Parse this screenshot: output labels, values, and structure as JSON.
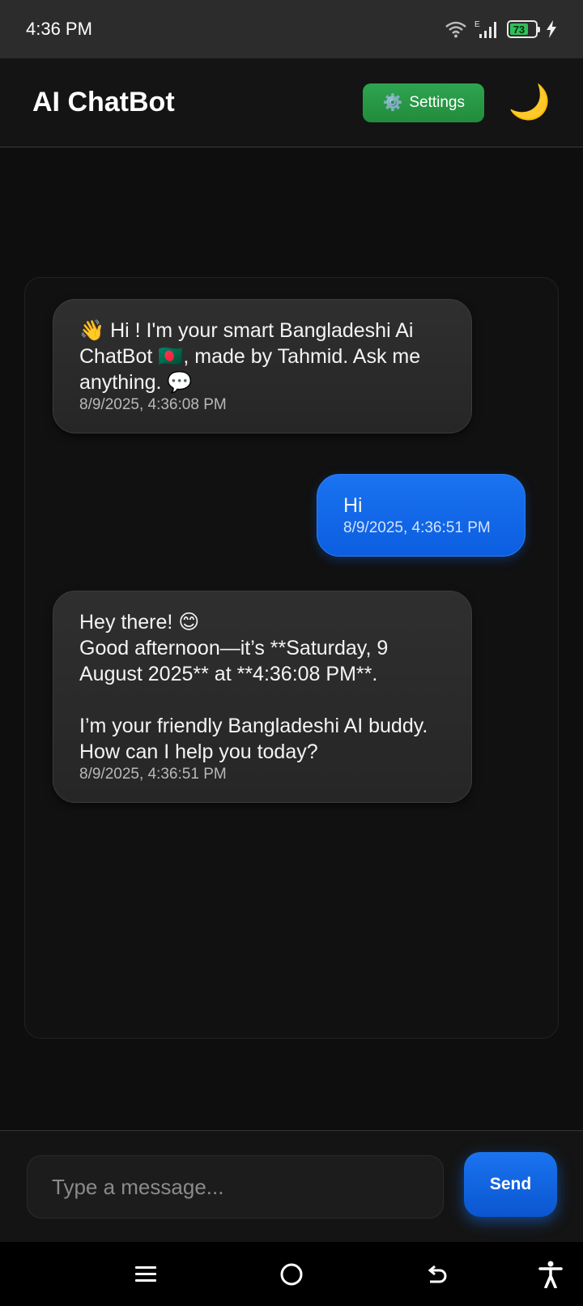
{
  "status_bar": {
    "time": "4:36 PM",
    "network_label": "E",
    "battery_percent": "73",
    "icons": [
      "wifi-icon",
      "signal-icon",
      "battery-icon",
      "charging-icon"
    ]
  },
  "header": {
    "title": "AI ChatBot",
    "settings_label": "Settings",
    "settings_icon": "⚙️",
    "theme_icon": "🌙"
  },
  "messages": [
    {
      "sender": "bot",
      "text": "👋 Hi ! I'm your smart Bangladeshi Ai ChatBot 🇧🇩, made by Tahmid. Ask me anything. 💬",
      "time": "8/9/2025, 4:36:08 PM"
    },
    {
      "sender": "user",
      "text": "Hi",
      "time": "8/9/2025, 4:36:51 PM"
    },
    {
      "sender": "bot",
      "text": "Hey there! 😊\nGood afternoon—it’s **Saturday, 9 August 2025** at **4:36:08 PM**.\n\nI’m your friendly Bangladeshi AI buddy. How can I help you today?",
      "time": "8/9/2025, 4:36:51 PM"
    }
  ],
  "composer": {
    "placeholder": "Type a message...",
    "value": "",
    "send_label": "Send"
  },
  "nav_bar": {
    "icons": [
      "menu-icon",
      "home-icon",
      "back-icon",
      "accessibility-icon"
    ]
  },
  "colors": {
    "background": "#0e0e0e",
    "accent_blue": "#1a73f0",
    "settings_green": "#2ea44f",
    "bot_bubble": "#2b2b2b"
  }
}
